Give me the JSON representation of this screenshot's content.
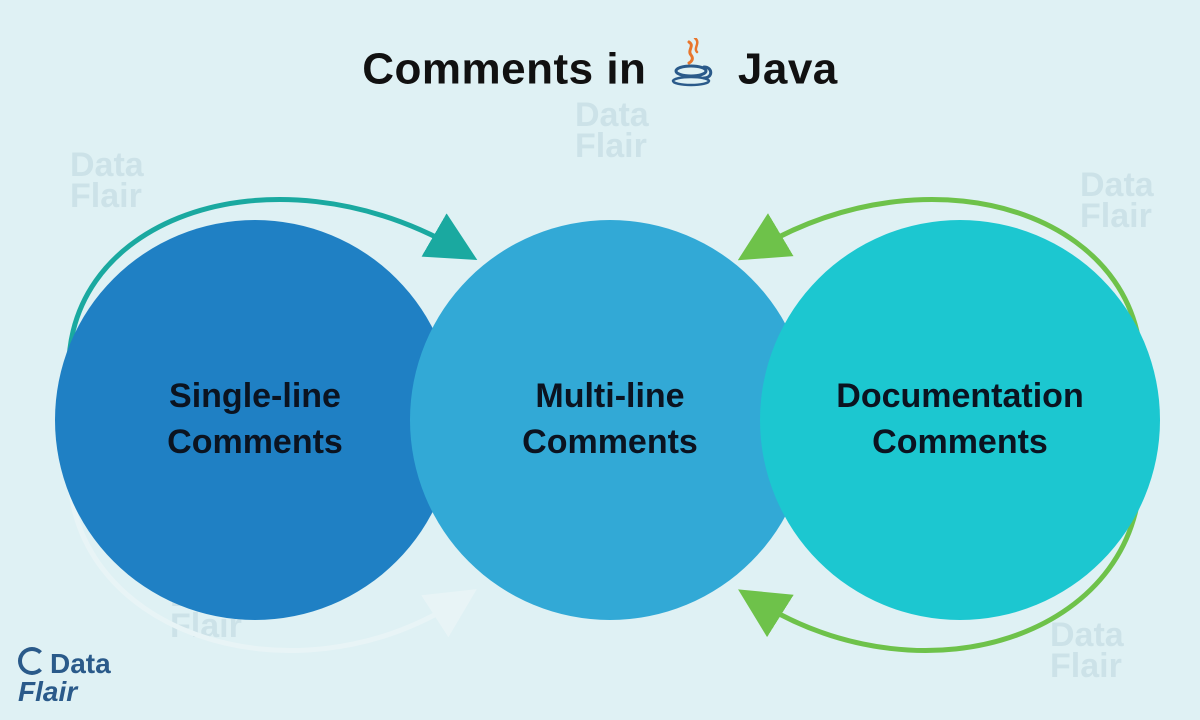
{
  "title": {
    "part1": "Comments in",
    "part2": "Java"
  },
  "circles": {
    "left": {
      "label": "Single-line\nComments",
      "color": "#1f80c4"
    },
    "middle": {
      "label": "Multi-line\nComments",
      "color": "#32a9d6"
    },
    "right": {
      "label": "Documentation\nComments",
      "color": "#1cc7d0"
    }
  },
  "arrows": {
    "left_top_color": "#1aa9a0",
    "left_bottom_color": "#e8f4f6",
    "right_top_color": "#6ec24a",
    "right_bottom_color": "#6ec24a"
  },
  "watermark_text": "Data\nFlair",
  "brand": {
    "line1": "Data",
    "line2": "Flair"
  }
}
